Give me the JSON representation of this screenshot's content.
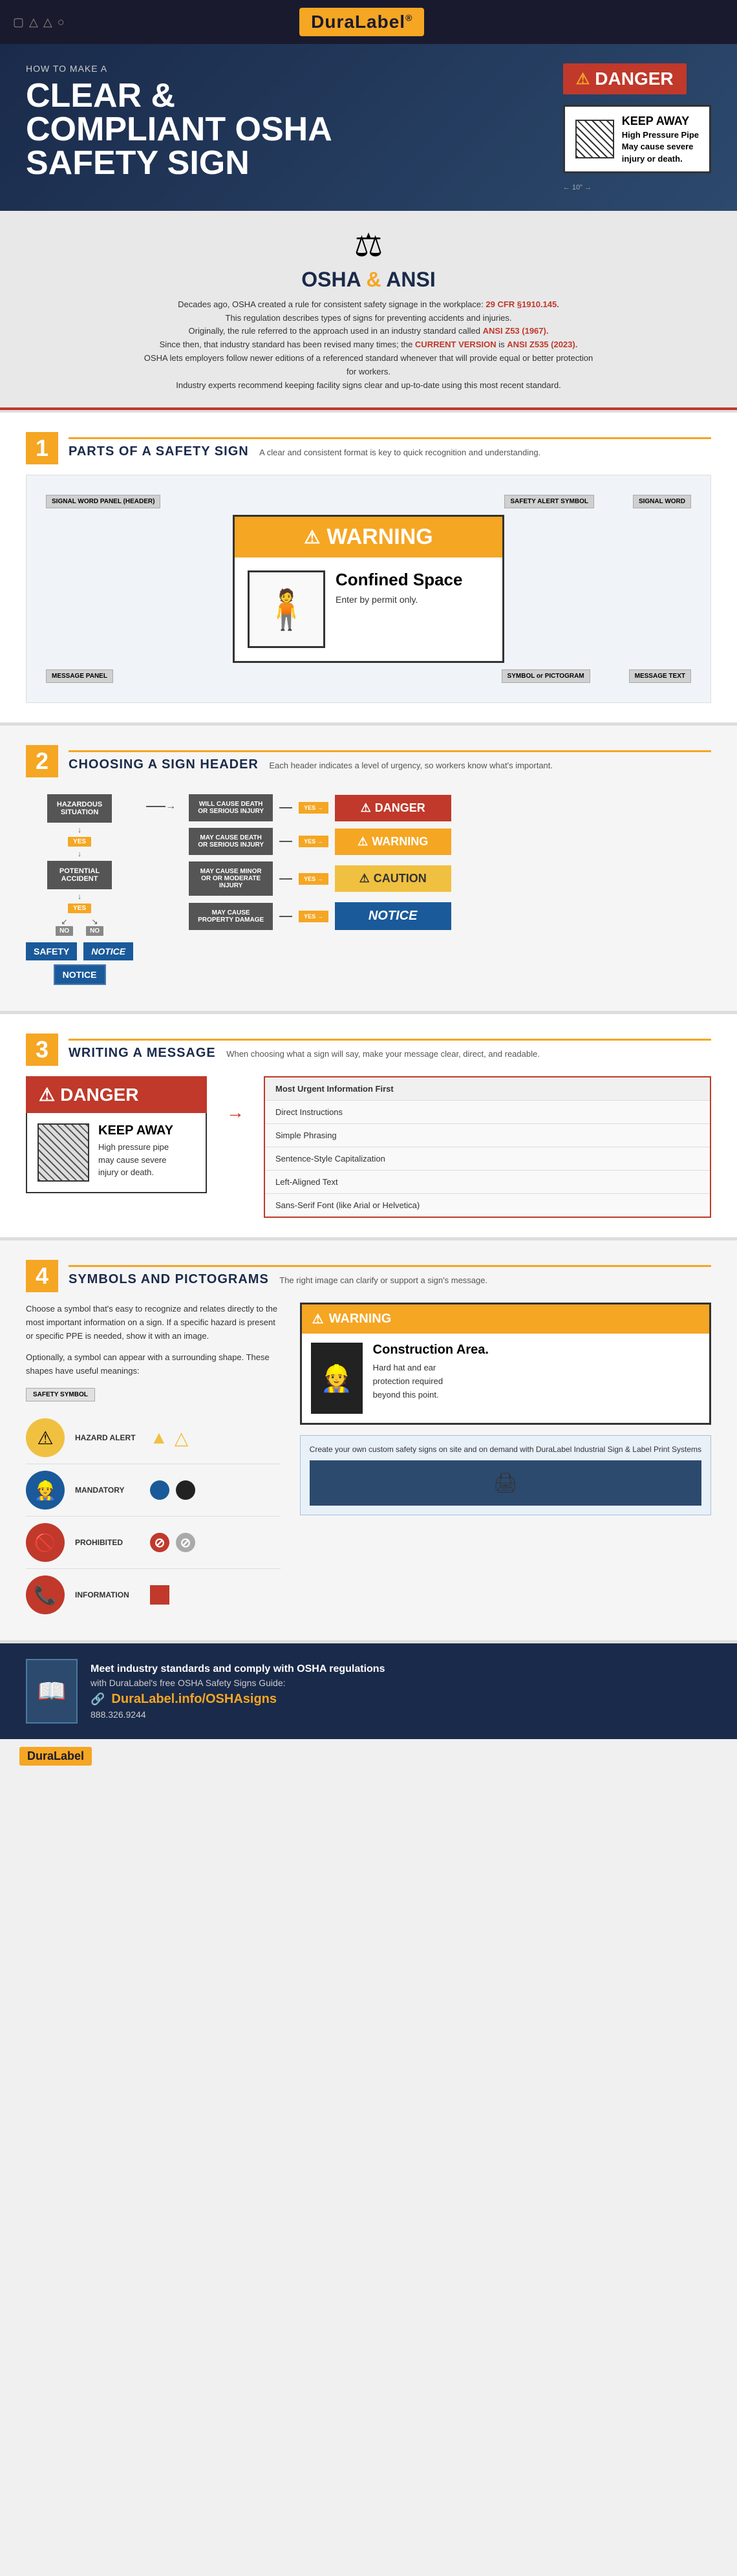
{
  "header": {
    "logo": "DuraLabel",
    "logo_reg": "®"
  },
  "hero": {
    "subtitle": "HOW TO MAKE A",
    "title_line1": "CLEAR &",
    "title_line2": "COMPLIANT OSHA",
    "title_line3": "SAFETY SIGN",
    "danger_label": "DANGER",
    "sign_example": {
      "title": "High Pressure Pipe",
      "subtitle": "May cause severe",
      "subtitle2": "injury or death.",
      "keep_away": "KEEP AWAY"
    }
  },
  "osha_section": {
    "title": "OSHA",
    "amp": "&",
    "title2": "ANSI",
    "p1": "Decades ago, OSHA created a rule for consistent safety signage in the workplace: 29 CFR §1910.145.",
    "p1_highlight": "29 CFR §1910.145",
    "p2": "This regulation describes types of signs for preventing accidents and injuries.",
    "p3": "Originally, the rule referred to the approach used in an industry standard called ANSI Z53 (1967).",
    "p3_highlight": "ANSI Z53 (1967)",
    "p4": "Since then, that industry standard has been revised many times; the CURRENT VERSION is ANSI Z535 (2023).",
    "p4_highlight": "CURRENT VERSION",
    "p4_highlight2": "ANSI Z535 (2023)",
    "p5": "OSHA lets employers follow newer editions of a referenced standard whenever that will provide equal or better protection for workers.",
    "p6": "Industry experts recommend keeping facility signs clear and up-to-date using this most recent standard."
  },
  "section1": {
    "number": "1",
    "title": "PARTS OF A SAFETY SIGN",
    "subtitle": "A clear and consistent format is key to quick recognition and understanding.",
    "labels": {
      "signal_word_panel": "SIGNAL WORD PANEL (HEADER)",
      "safety_alert_symbol": "SAFETY ALERT SYMBOL",
      "signal_word": "SIGNAL WORD",
      "symbol_pictogram": "SYMBOL or PICTOGRAM",
      "message_panel": "MESSAGE PANEL",
      "message_text": "MESSAGE TEXT"
    },
    "sign": {
      "header": "WARNING",
      "title": "Confined Space",
      "body": "Enter by permit only."
    }
  },
  "section2": {
    "number": "2",
    "title": "CHOOSING A SIGN HEADER",
    "subtitle": "Each header indicates a level of urgency, so workers know what's important.",
    "flow": {
      "hazardous": "HAZARDOUS SITUATION",
      "potential": "POTENTIAL ACCIDENT",
      "yes": "YES",
      "no": "NO"
    },
    "outcomes": [
      {
        "condition": "WILL CAUSE DEATH OR SERIOUS INJURY",
        "result": "DANGER",
        "type": "danger"
      },
      {
        "condition": "MAY CAUSE DEATH OR SERIOUS INJURY",
        "result": "WARNING",
        "type": "warning"
      },
      {
        "condition": "MAY CAUSE MINOR OR OR MODERATE INJURY",
        "result": "CAUTION",
        "type": "caution"
      },
      {
        "condition": "MAY CAUSE PROPERTY DAMAGE",
        "result": "NOTICE",
        "type": "notice"
      }
    ],
    "bottom_signs": [
      "SAFETY",
      "NOTICE",
      "NOTICE"
    ]
  },
  "section3": {
    "number": "3",
    "title": "WRITING A MESSAGE",
    "subtitle": "When choosing what a sign will say, make your message clear, direct, and readable.",
    "sign": {
      "header": "DANGER",
      "keep_away": "KEEP AWAY",
      "body1": "High pressure pipe",
      "body2": "may cause severe",
      "body3": "injury or death."
    },
    "tips": [
      "Most Urgent Information First",
      "Direct Instructions",
      "Simple Phrasing",
      "Sentence-Style Capitalization",
      "Left-Aligned Text",
      "Sans-Serif Font (like Arial or Helvetica)"
    ]
  },
  "section4": {
    "number": "4",
    "title": "SYMBOLS AND PICTOGRAMS",
    "subtitle": "The right image can clarify or support a sign's message.",
    "intro": "Choose a symbol that's easy to recognize and relates directly to the most important information on a sign. If a specific hazard is present or specific PPE is needed, show it with an image.",
    "intro2": "Optionally, a symbol can appear with a surrounding shape. These shapes have useful meanings:",
    "safety_symbol_label": "SAFETY SYMBOL",
    "symbol_rows": [
      {
        "label": "HAZARD ALERT",
        "icon": "⚠",
        "shapes": [
          "▲",
          "△"
        ]
      },
      {
        "label": "MANDATORY",
        "icon": "👷",
        "shapes": [
          "●",
          "⚫"
        ]
      },
      {
        "label": "PROHIBITED",
        "icon": "🚫",
        "shapes": [
          "🚫",
          "⊘"
        ]
      },
      {
        "label": "INFORMATION",
        "icon": "📞",
        "shapes": [
          "■"
        ]
      }
    ],
    "warning_sign": {
      "header": "WARNING",
      "title": "Construction Area.",
      "body1": "Hard hat and ear",
      "body2": "protection required",
      "body3": "beyond this point."
    },
    "cta_text": "Create your own custom safety signs on site and on demand with DuraLabel Industrial Sign & Label Print Systems"
  },
  "cta": {
    "text1": "Meet industry standards and comply with OSHA regulations",
    "text2": "with DuraLabel's free OSHA Safety Signs Guide:",
    "link": "DuraLabel.info/OSHAsigns",
    "phone": "888.326.9244"
  },
  "footer": {
    "logo": "DuraLabel"
  }
}
